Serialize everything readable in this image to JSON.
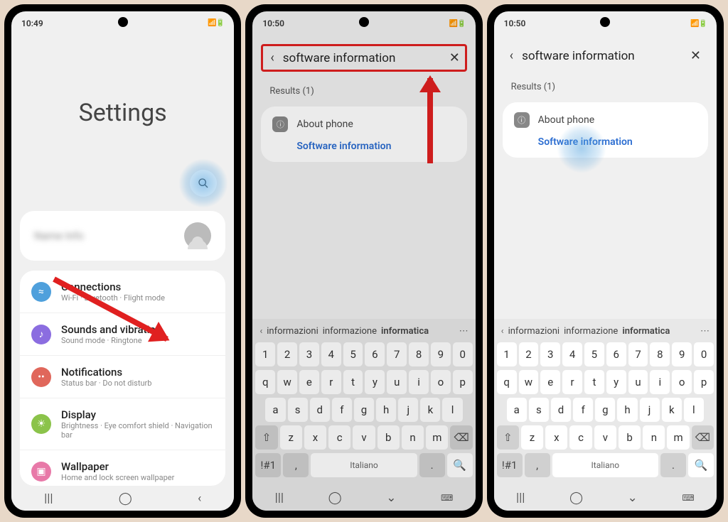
{
  "p1": {
    "time": "10:49",
    "title": "Settings",
    "items": [
      {
        "color": "#4fa0dc",
        "glyph": "≈",
        "label": "Connections",
        "sub": "Wi-Fi · Bluetooth · Flight mode"
      },
      {
        "color": "#8b6de0",
        "glyph": "♪",
        "label": "Sounds and vibration",
        "sub": "Sound mode · Ringtone"
      },
      {
        "color": "#e0675b",
        "glyph": "••",
        "label": "Notifications",
        "sub": "Status bar · Do not disturb"
      },
      {
        "color": "#8bc34a",
        "glyph": "☀",
        "label": "Display",
        "sub": "Brightness · Eye comfort shield · Navigation bar"
      },
      {
        "color": "#e879a8",
        "glyph": "▣",
        "label": "Wallpaper",
        "sub": "Home and lock screen wallpaper"
      }
    ]
  },
  "p2": {
    "time": "10:50",
    "search": "software information",
    "results_hdr": "Results (1)",
    "parent": "About phone",
    "hit": "Software information"
  },
  "p3": {
    "time": "10:50",
    "search": "software information",
    "results_hdr": "Results (1)",
    "parent": "About phone",
    "hit": "Software information"
  },
  "kbd": {
    "sugg": [
      "informazioni",
      "informazione",
      "informatica"
    ],
    "r1": [
      "1",
      "2",
      "3",
      "4",
      "5",
      "6",
      "7",
      "8",
      "9",
      "0"
    ],
    "r2": [
      "q",
      "w",
      "e",
      "r",
      "t",
      "y",
      "u",
      "i",
      "o",
      "p"
    ],
    "r3": [
      "a",
      "s",
      "d",
      "f",
      "g",
      "h",
      "j",
      "k",
      "l"
    ],
    "r4": [
      "z",
      "x",
      "c",
      "v",
      "b",
      "n",
      "m"
    ],
    "lang": "Italiano",
    "sym": "!#1"
  }
}
